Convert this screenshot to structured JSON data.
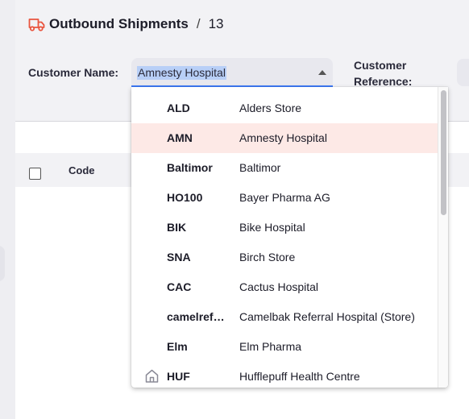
{
  "breadcrumb": {
    "title": "Outbound Shipments",
    "separator": "/",
    "number": "13"
  },
  "form": {
    "customer_label": "Customer Name:",
    "customer_value": "Amnesty Hospital",
    "reference_label": "Customer Reference:"
  },
  "table": {
    "code_header": "Code"
  },
  "dropdown": {
    "items": [
      {
        "code": "ALD",
        "name": "Alders Store"
      },
      {
        "code": "AMN",
        "name": "Amnesty Hospital"
      },
      {
        "code": "Baltimor",
        "name": "Baltimor"
      },
      {
        "code": "HO100",
        "name": "Bayer Pharma AG"
      },
      {
        "code": "BIK",
        "name": "Bike Hospital"
      },
      {
        "code": "SNA",
        "name": "Birch Store"
      },
      {
        "code": "CAC",
        "name": "Cactus Hospital"
      },
      {
        "code": "camelref…",
        "name": "Camelbak Referral Hospital (Store)"
      },
      {
        "code": "Elm",
        "name": "Elm Pharma"
      },
      {
        "code": "HUF",
        "name": "Hufflepuff Health Centre"
      }
    ],
    "selected_index": 1,
    "home_icon_index": 9
  },
  "colors": {
    "accent": "#e9553f",
    "focus": "#3e7bfa",
    "selected_row": "#fde9e6"
  },
  "icons": {
    "breadcrumb": "truck-icon",
    "dropdown_row": "home-icon",
    "combo": "chevron-up-icon"
  }
}
